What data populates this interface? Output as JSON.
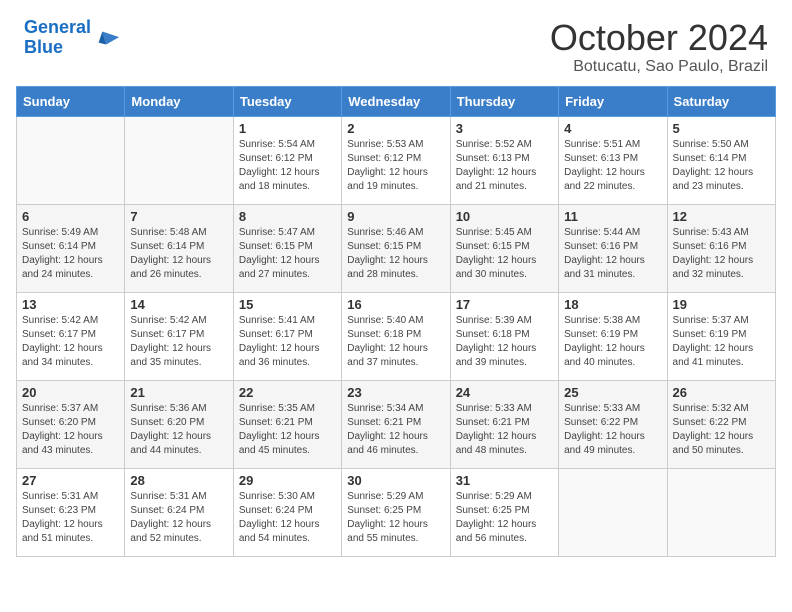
{
  "header": {
    "logo_line1": "General",
    "logo_line2": "Blue",
    "month": "October 2024",
    "location": "Botucatu, Sao Paulo, Brazil"
  },
  "weekdays": [
    "Sunday",
    "Monday",
    "Tuesday",
    "Wednesday",
    "Thursday",
    "Friday",
    "Saturday"
  ],
  "weeks": [
    [
      {
        "day": "",
        "info": ""
      },
      {
        "day": "",
        "info": ""
      },
      {
        "day": "1",
        "info": "Sunrise: 5:54 AM\nSunset: 6:12 PM\nDaylight: 12 hours and 18 minutes."
      },
      {
        "day": "2",
        "info": "Sunrise: 5:53 AM\nSunset: 6:12 PM\nDaylight: 12 hours and 19 minutes."
      },
      {
        "day": "3",
        "info": "Sunrise: 5:52 AM\nSunset: 6:13 PM\nDaylight: 12 hours and 21 minutes."
      },
      {
        "day": "4",
        "info": "Sunrise: 5:51 AM\nSunset: 6:13 PM\nDaylight: 12 hours and 22 minutes."
      },
      {
        "day": "5",
        "info": "Sunrise: 5:50 AM\nSunset: 6:14 PM\nDaylight: 12 hours and 23 minutes."
      }
    ],
    [
      {
        "day": "6",
        "info": "Sunrise: 5:49 AM\nSunset: 6:14 PM\nDaylight: 12 hours and 24 minutes."
      },
      {
        "day": "7",
        "info": "Sunrise: 5:48 AM\nSunset: 6:14 PM\nDaylight: 12 hours and 26 minutes."
      },
      {
        "day": "8",
        "info": "Sunrise: 5:47 AM\nSunset: 6:15 PM\nDaylight: 12 hours and 27 minutes."
      },
      {
        "day": "9",
        "info": "Sunrise: 5:46 AM\nSunset: 6:15 PM\nDaylight: 12 hours and 28 minutes."
      },
      {
        "day": "10",
        "info": "Sunrise: 5:45 AM\nSunset: 6:15 PM\nDaylight: 12 hours and 30 minutes."
      },
      {
        "day": "11",
        "info": "Sunrise: 5:44 AM\nSunset: 6:16 PM\nDaylight: 12 hours and 31 minutes."
      },
      {
        "day": "12",
        "info": "Sunrise: 5:43 AM\nSunset: 6:16 PM\nDaylight: 12 hours and 32 minutes."
      }
    ],
    [
      {
        "day": "13",
        "info": "Sunrise: 5:42 AM\nSunset: 6:17 PM\nDaylight: 12 hours and 34 minutes."
      },
      {
        "day": "14",
        "info": "Sunrise: 5:42 AM\nSunset: 6:17 PM\nDaylight: 12 hours and 35 minutes."
      },
      {
        "day": "15",
        "info": "Sunrise: 5:41 AM\nSunset: 6:17 PM\nDaylight: 12 hours and 36 minutes."
      },
      {
        "day": "16",
        "info": "Sunrise: 5:40 AM\nSunset: 6:18 PM\nDaylight: 12 hours and 37 minutes."
      },
      {
        "day": "17",
        "info": "Sunrise: 5:39 AM\nSunset: 6:18 PM\nDaylight: 12 hours and 39 minutes."
      },
      {
        "day": "18",
        "info": "Sunrise: 5:38 AM\nSunset: 6:19 PM\nDaylight: 12 hours and 40 minutes."
      },
      {
        "day": "19",
        "info": "Sunrise: 5:37 AM\nSunset: 6:19 PM\nDaylight: 12 hours and 41 minutes."
      }
    ],
    [
      {
        "day": "20",
        "info": "Sunrise: 5:37 AM\nSunset: 6:20 PM\nDaylight: 12 hours and 43 minutes."
      },
      {
        "day": "21",
        "info": "Sunrise: 5:36 AM\nSunset: 6:20 PM\nDaylight: 12 hours and 44 minutes."
      },
      {
        "day": "22",
        "info": "Sunrise: 5:35 AM\nSunset: 6:21 PM\nDaylight: 12 hours and 45 minutes."
      },
      {
        "day": "23",
        "info": "Sunrise: 5:34 AM\nSunset: 6:21 PM\nDaylight: 12 hours and 46 minutes."
      },
      {
        "day": "24",
        "info": "Sunrise: 5:33 AM\nSunset: 6:21 PM\nDaylight: 12 hours and 48 minutes."
      },
      {
        "day": "25",
        "info": "Sunrise: 5:33 AM\nSunset: 6:22 PM\nDaylight: 12 hours and 49 minutes."
      },
      {
        "day": "26",
        "info": "Sunrise: 5:32 AM\nSunset: 6:22 PM\nDaylight: 12 hours and 50 minutes."
      }
    ],
    [
      {
        "day": "27",
        "info": "Sunrise: 5:31 AM\nSunset: 6:23 PM\nDaylight: 12 hours and 51 minutes."
      },
      {
        "day": "28",
        "info": "Sunrise: 5:31 AM\nSunset: 6:24 PM\nDaylight: 12 hours and 52 minutes."
      },
      {
        "day": "29",
        "info": "Sunrise: 5:30 AM\nSunset: 6:24 PM\nDaylight: 12 hours and 54 minutes."
      },
      {
        "day": "30",
        "info": "Sunrise: 5:29 AM\nSunset: 6:25 PM\nDaylight: 12 hours and 55 minutes."
      },
      {
        "day": "31",
        "info": "Sunrise: 5:29 AM\nSunset: 6:25 PM\nDaylight: 12 hours and 56 minutes."
      },
      {
        "day": "",
        "info": ""
      },
      {
        "day": "",
        "info": ""
      }
    ]
  ]
}
